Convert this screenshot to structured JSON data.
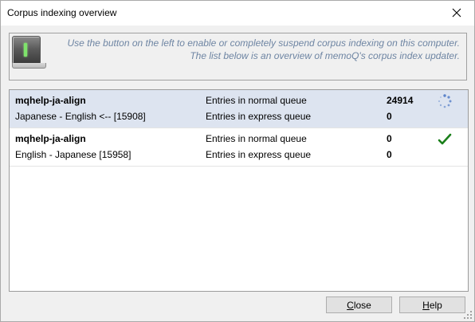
{
  "window": {
    "title": "Corpus indexing overview"
  },
  "header": {
    "info_line1": "Use the button on the left to enable or completely suspend corpus indexing on this computer.",
    "info_line2": "The list below is an overview of memoQ's corpus index updater."
  },
  "rows": [
    {
      "name": "mqhelp-ja-align",
      "languages": "Japanese - English <-- [15908]",
      "normal_label": "Entries in normal queue",
      "normal_value": "24914",
      "express_label": "Entries in express queue",
      "express_value": "0",
      "status": "processing-spinner-icon"
    },
    {
      "name": "mqhelp-ja-align",
      "languages": "English - Japanese [15958]",
      "normal_label": "Entries in normal queue",
      "normal_value": "0",
      "express_label": "Entries in express queue",
      "express_value": "0",
      "status": "checkmark-icon"
    }
  ],
  "buttons": {
    "close_first": "C",
    "close_rest": "lose",
    "help_first": "H",
    "help_rest": "elp"
  },
  "colors": {
    "info_text": "#6e85a3",
    "selected_row": "#dde4f0",
    "led": "#7ee36b",
    "check": "#1a7f1a"
  }
}
